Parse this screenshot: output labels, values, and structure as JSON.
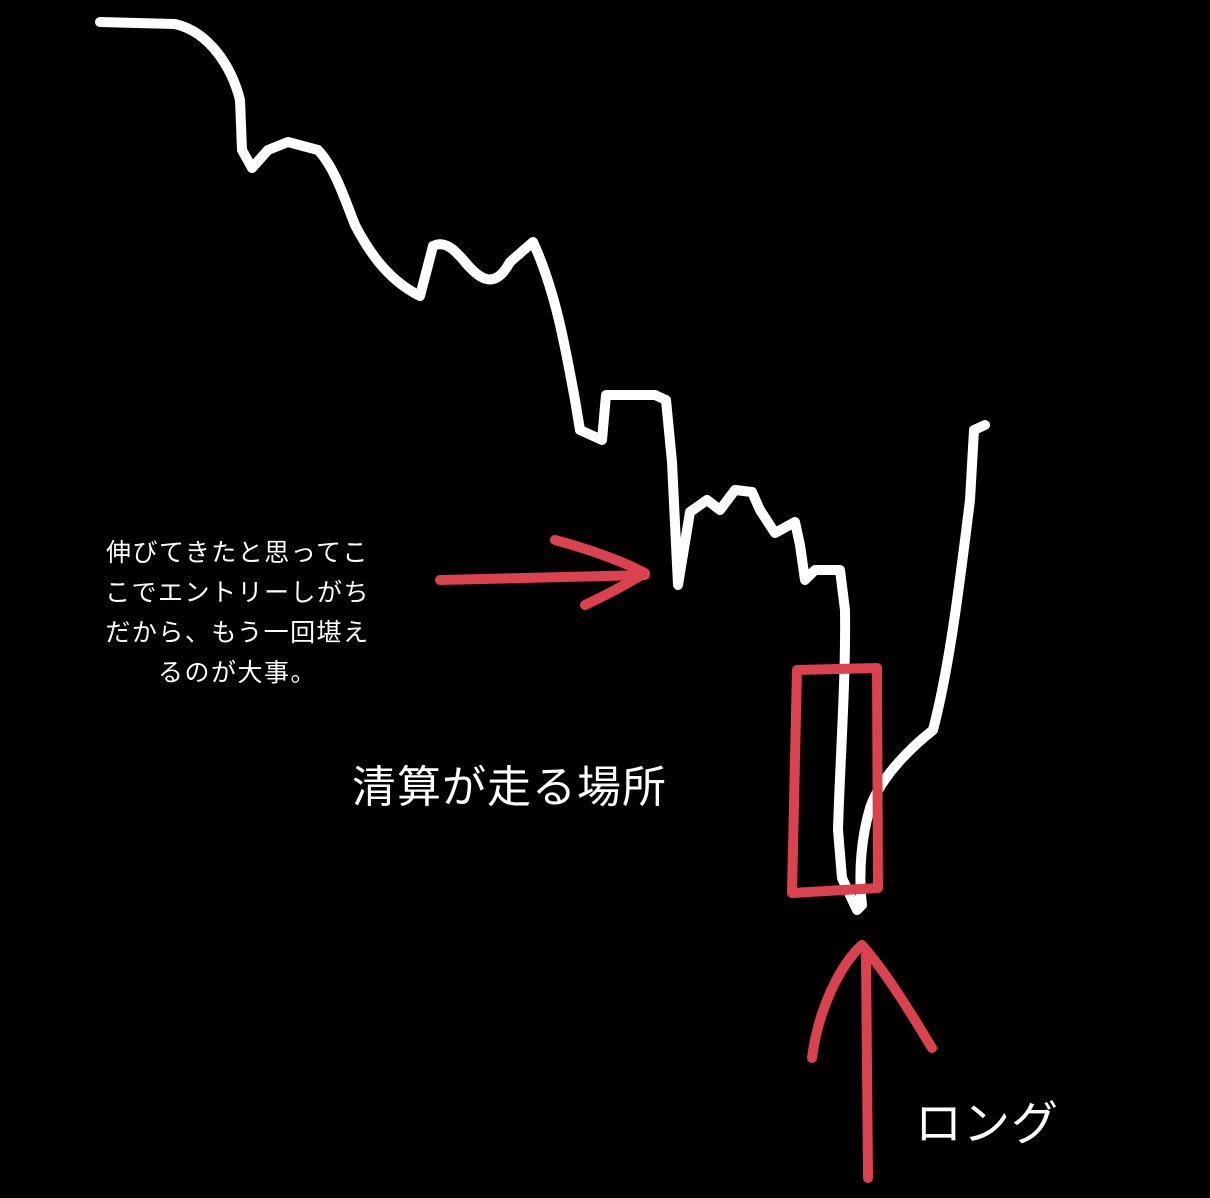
{
  "colors": {
    "background": "#000000",
    "price_line": "#ffffff",
    "annotation": "#d9424e",
    "text": "#ffffff"
  },
  "annotations": {
    "entry_warning_lines": [
      "伸びてきたと思ってこ",
      "こでエントリーしがち",
      "だから、もう一回堪え",
      "るのが大事。"
    ],
    "liquidation_zone_label": "清算が走る場所",
    "long_label": "ロング"
  }
}
